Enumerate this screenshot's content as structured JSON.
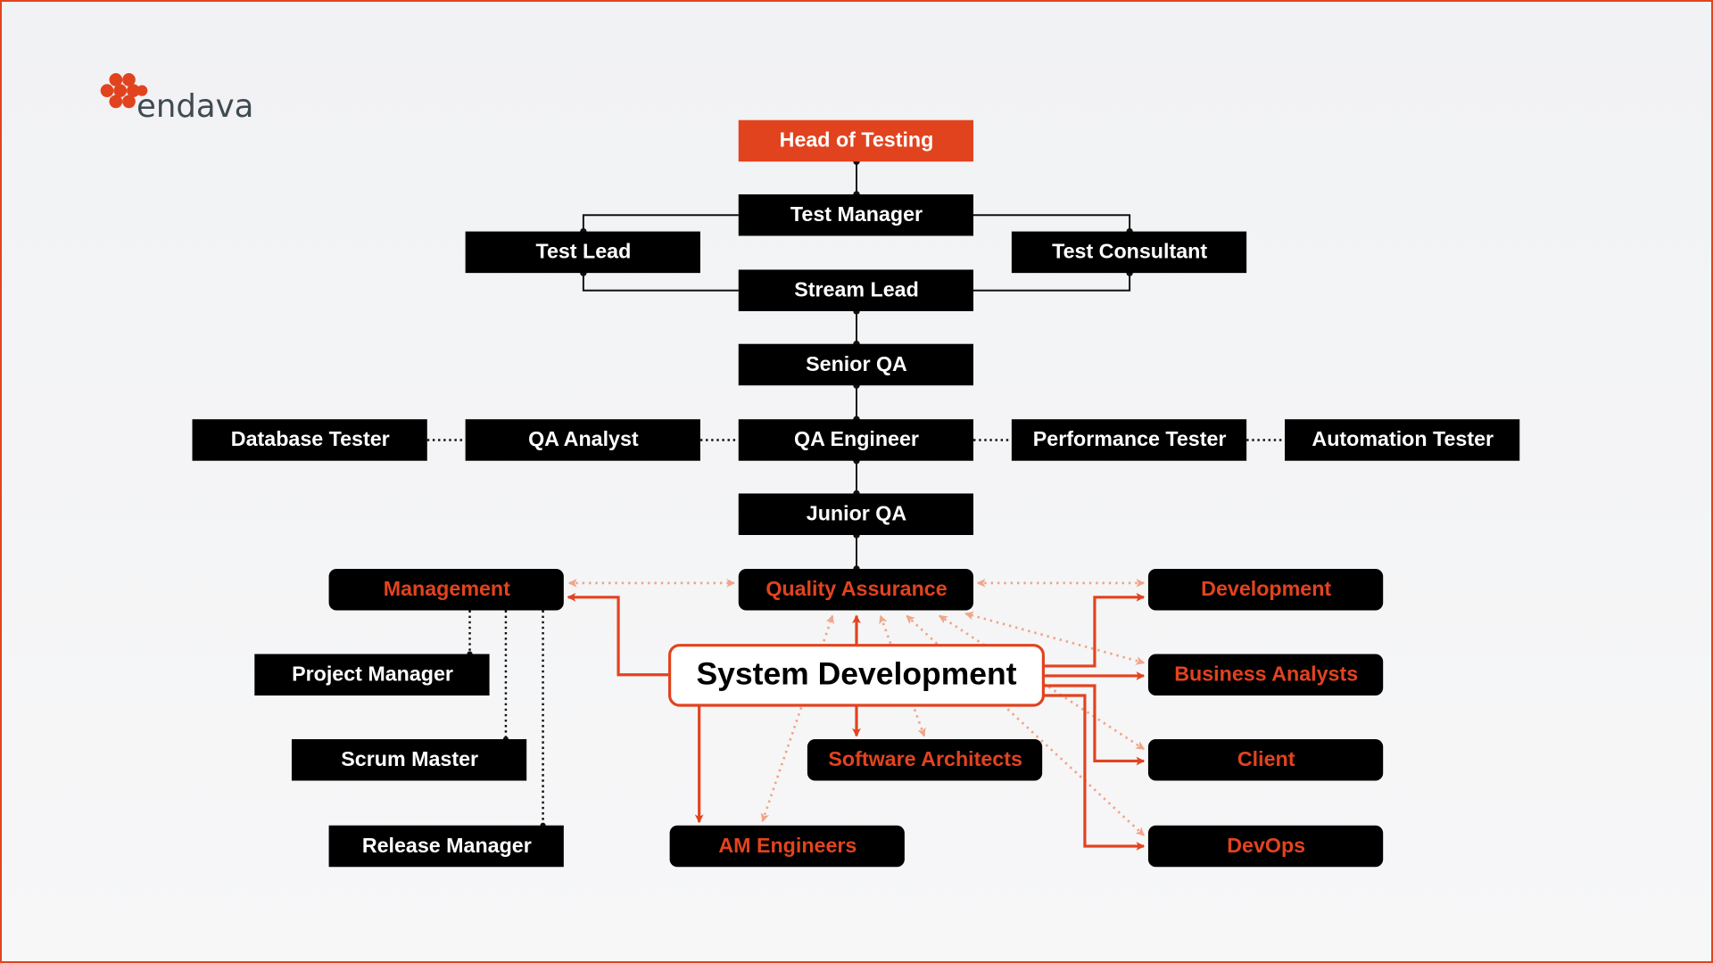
{
  "logo": {
    "text": "endava"
  },
  "colors": {
    "accent": "#e2431f",
    "box": "#000000",
    "dotted": "#f0a58a",
    "background": "#f3f4f5"
  },
  "nodes": {
    "head": "Head of Testing",
    "test_manager": "Test Manager",
    "test_lead": "Test Lead",
    "test_consultant": "Test Consultant",
    "stream_lead": "Stream Lead",
    "senior_qa": "Senior QA",
    "database_tester": "Database Tester",
    "qa_analyst": "QA Analyst",
    "qa_engineer": "QA Engineer",
    "performance_tester": "Performance Tester",
    "automation_tester": "Automation Tester",
    "junior_qa": "Junior QA",
    "management": "Management",
    "quality_assurance": "Quality Assurance",
    "development": "Development",
    "project_manager": "Project Manager",
    "scrum_master": "Scrum Master",
    "release_manager": "Release Manager",
    "system_development": "System Development",
    "software_architects": "Software Architects",
    "am_engineers": "AM Engineers",
    "business_analysts": "Business Analysts",
    "client": "Client",
    "devops": "DevOps"
  }
}
